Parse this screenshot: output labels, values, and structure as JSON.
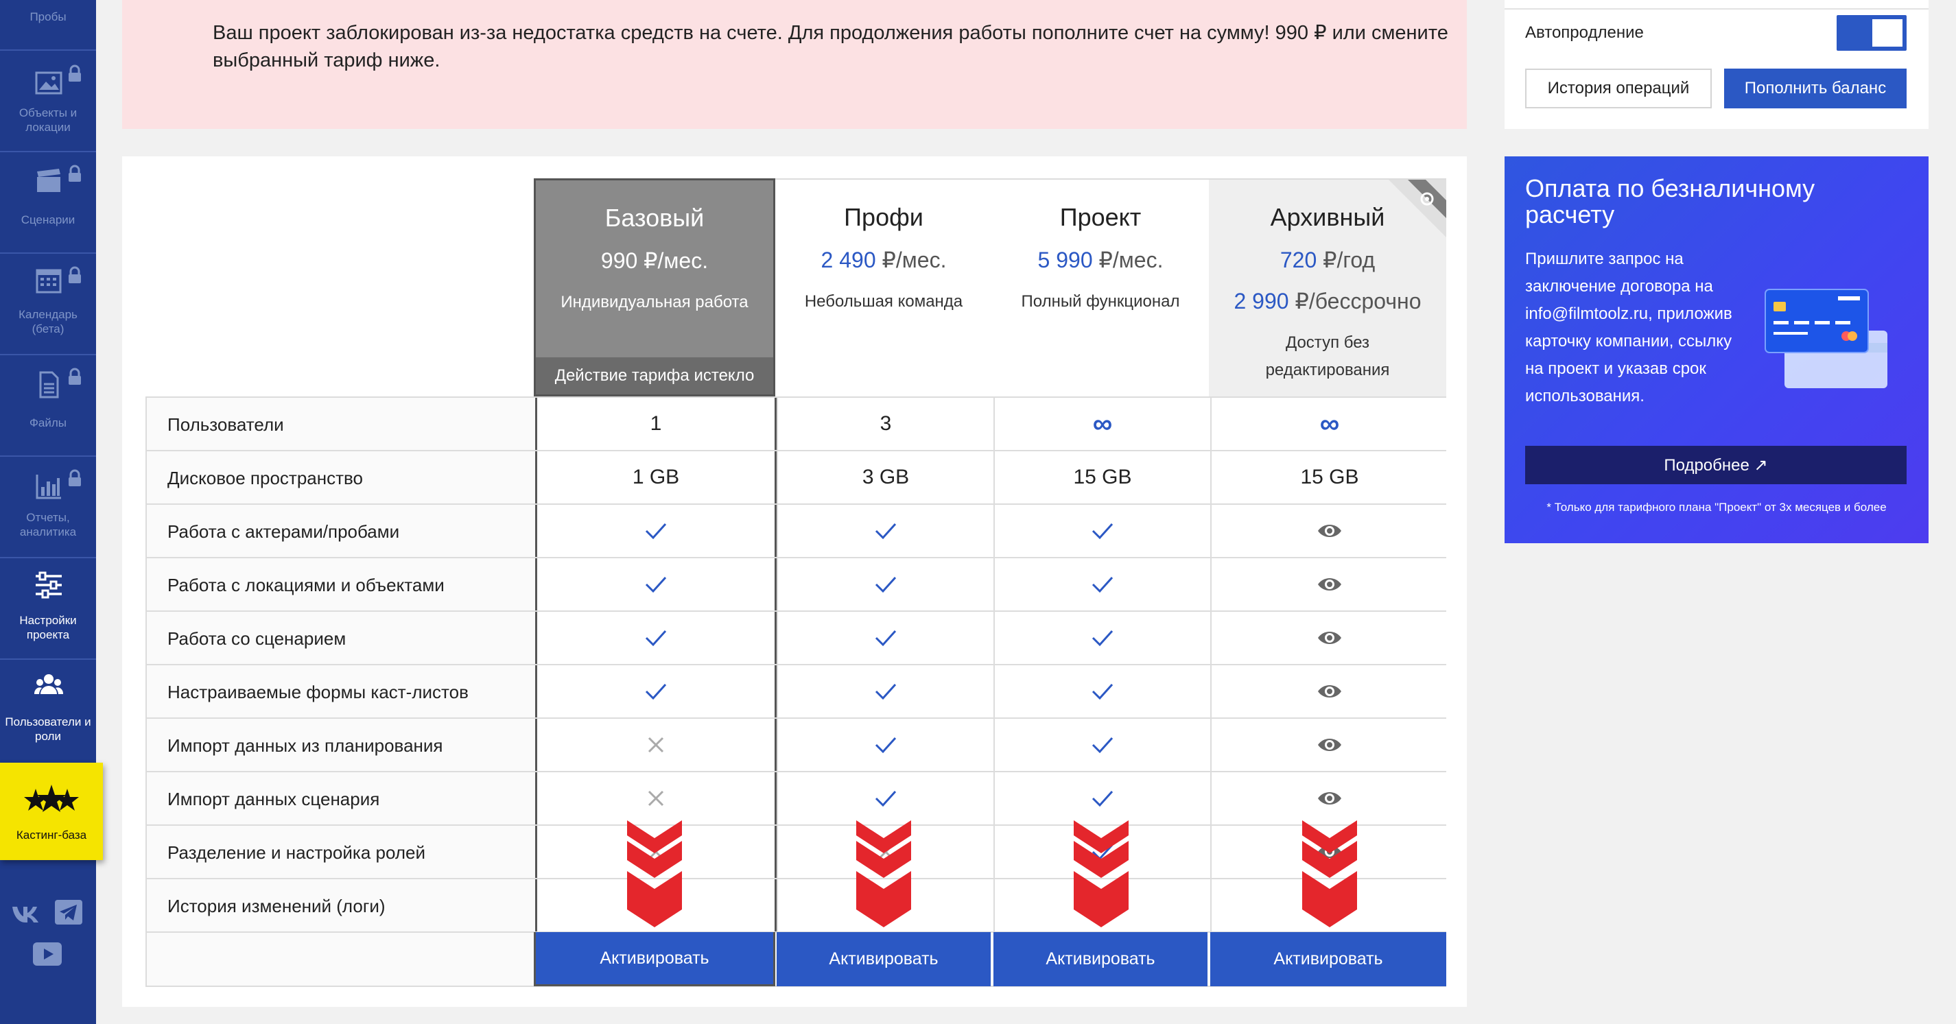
{
  "sidebar": {
    "items": [
      {
        "label": "Пробы",
        "icon": "probes-icon"
      },
      {
        "label": "Объекты и локации",
        "icon": "image-icon",
        "locked": true
      },
      {
        "label": "Сценарии",
        "icon": "clapperboard-icon",
        "locked": true
      },
      {
        "label": "Календарь (бета)",
        "icon": "calendar-icon",
        "locked": true
      },
      {
        "label": "Файлы",
        "icon": "file-icon",
        "locked": true
      },
      {
        "label": "Отчеты, аналитика",
        "icon": "bar-chart-icon",
        "locked": true
      },
      {
        "label": "Настройки проекта",
        "icon": "sliders-icon",
        "active": true
      },
      {
        "label": "Пользователи и роли",
        "icon": "users-icon",
        "active": true
      },
      {
        "label": "Кастинг-база",
        "icon": "stars-icon",
        "highlight": true
      }
    ],
    "social": [
      "vk-icon",
      "telegram-icon",
      "youtube-icon"
    ]
  },
  "alert": {
    "text": "Ваш проект заблокирован из-за недостатка средств на счете. Для продолжения работы пополните счет на сумму! 990 ₽ или смените выбранный тариф ниже."
  },
  "account": {
    "autorenew_label": "Автопродление",
    "autorenew_on": true,
    "history_button": "История операций",
    "topup_button": "Пополнить баланс"
  },
  "promo": {
    "title": "Оплата по безналичному расчету",
    "body": "Пришлите запрос на заключение договора на info@filmtoolz.ru, приложив карточку компании, ссылку на проект и указав срок использования.",
    "more_button": "Подробнее ↗",
    "footnote": "* Только для тарифного плана \"Проект\" от 3х месяцев и более"
  },
  "plans": [
    {
      "name": "Базовый",
      "price_num": "990",
      "price_unit": " ₽/мес.",
      "desc": "Индивидуальная работа",
      "status": "Действие тарифа истекло",
      "current": true,
      "button": "Активировать"
    },
    {
      "name": "Профи",
      "price_num": "2 490",
      "price_unit": " ₽/мес.",
      "desc": "Небольшая команда",
      "button": "Активировать"
    },
    {
      "name": "Проект",
      "price_num": "5 990",
      "price_unit": " ₽/мес.",
      "desc": "Полный функционал",
      "button": "Активировать"
    },
    {
      "name": "Архивный",
      "price_num": "720",
      "price_unit": " ₽/год",
      "price2_num": "2 990",
      "price2_unit": " ₽/бессрочно",
      "desc": "Доступ без редактирования",
      "button": "Активировать"
    }
  ],
  "features": [
    {
      "label": "Пользователи",
      "values": [
        "1",
        "3",
        "∞",
        "∞"
      ]
    },
    {
      "label": "Дисковое пространство",
      "values": [
        "1 GB",
        "3 GB",
        "15 GB",
        "15 GB"
      ]
    },
    {
      "label": "Работа с актерами/пробами",
      "values": [
        "check",
        "check",
        "check",
        "eye"
      ]
    },
    {
      "label": "Работа с локациями и объектами",
      "values": [
        "check",
        "check",
        "check",
        "eye"
      ]
    },
    {
      "label": "Работа со сценарием",
      "values": [
        "check",
        "check",
        "check",
        "eye"
      ]
    },
    {
      "label": "Настраиваемые формы каст-листов",
      "values": [
        "check",
        "check",
        "check",
        "eye"
      ]
    },
    {
      "label": "Импорт данных из планирования",
      "values": [
        "cross",
        "check",
        "check",
        "eye"
      ]
    },
    {
      "label": "Импорт данных сценария",
      "values": [
        "cross",
        "check",
        "check",
        "eye"
      ]
    },
    {
      "label": "Разделение и настройка ролей",
      "values": [
        "cross",
        "cross",
        "check",
        "eye"
      ]
    },
    {
      "label": "История изменений (логи)",
      "values": [
        "",
        "",
        "",
        ""
      ]
    }
  ],
  "colors": {
    "brand": "#2b58c4",
    "sidebar": "#1f3a8a",
    "alert_bg": "#fce1e3",
    "chevron": "#e4262c",
    "casting": "#f5e400"
  }
}
